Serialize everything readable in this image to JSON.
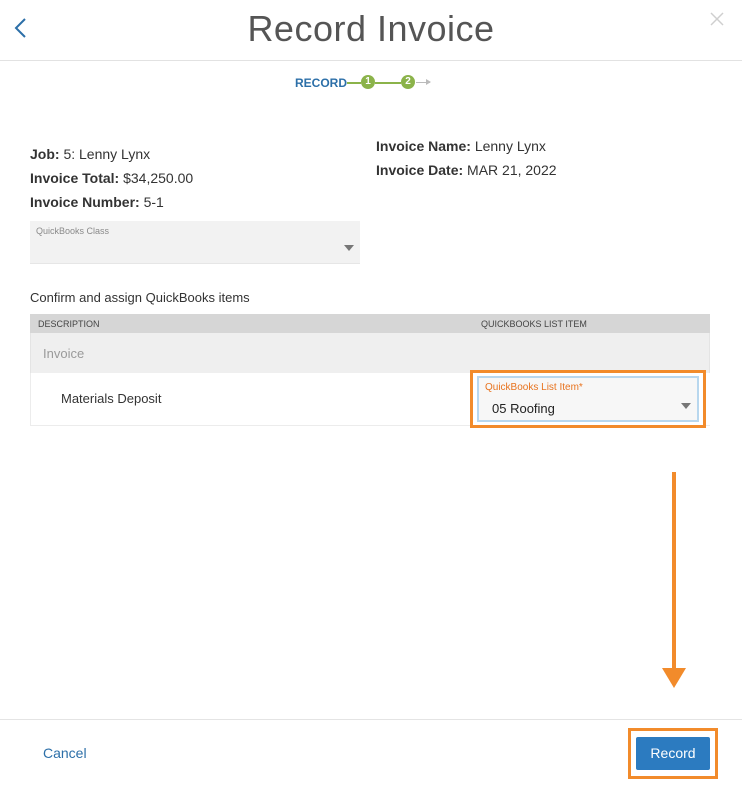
{
  "header": {
    "title": "Record Invoice",
    "back_icon": "chevron-left-icon",
    "close_icon": "close-icon"
  },
  "stepper": {
    "label": "RECORD",
    "steps": [
      "1",
      "2"
    ],
    "complete_color": "#8bb34a"
  },
  "job": {
    "label": "Job:",
    "value": "5: Lenny Lynx"
  },
  "invoice_total": {
    "label": "Invoice Total:",
    "value": "$34,250.00"
  },
  "invoice_number": {
    "label": "Invoice Number:",
    "value": "5-1"
  },
  "invoice_name": {
    "label": "Invoice Name:",
    "value": "Lenny Lynx"
  },
  "invoice_date": {
    "label": "Invoice Date:",
    "value": "MAR 21, 2022"
  },
  "quickbooks_class": {
    "label": "QuickBooks Class",
    "value": ""
  },
  "assign_label": "Confirm and assign QuickBooks items",
  "table": {
    "columns": [
      "DESCRIPTION",
      "QUICKBOOKS LIST ITEM"
    ],
    "group": "Invoice",
    "rows": [
      {
        "description": "Materials Deposit",
        "qb_label": "QuickBooks List Item*",
        "qb_value": "05 Roofing"
      }
    ]
  },
  "footer": {
    "cancel_label": "Cancel",
    "record_label": "Record"
  },
  "colors": {
    "accent": "#2c7bc0",
    "highlight": "#f28b2b",
    "link": "#2c6fa8"
  }
}
